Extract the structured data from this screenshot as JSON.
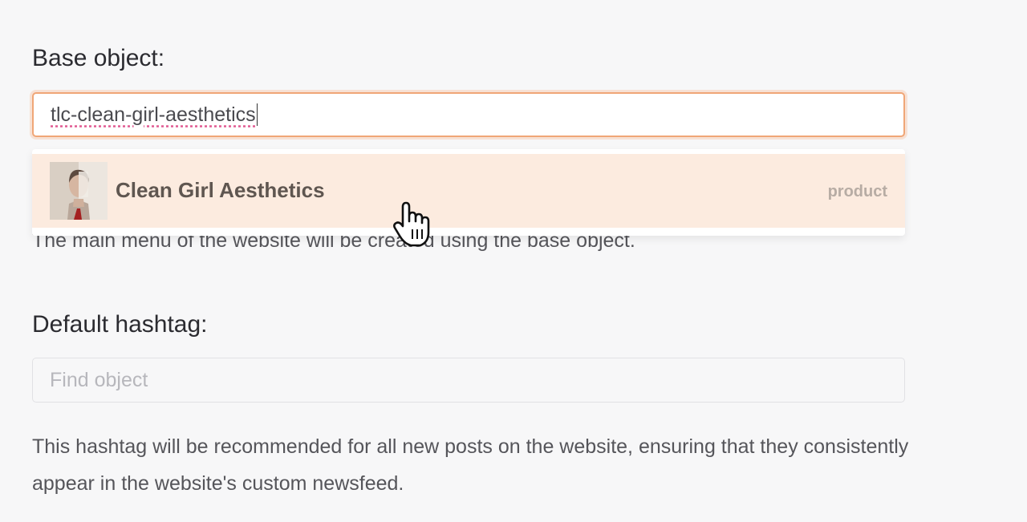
{
  "base_object": {
    "label": "Base object:",
    "input_value": "tlc-clean-girl-aesthetics",
    "suggestion": {
      "title": "Clean Girl Aesthetics",
      "type": "product",
      "thumbnail_icon": "portrait-thumbnail"
    },
    "help_text": "The main menu of the website will be created using the base object."
  },
  "default_hashtag": {
    "label": "Default hashtag:",
    "input_placeholder": "Find object",
    "help_text": "This hashtag will be recommended for all new posts on the website, ensuring that they consistently appear in the website's custom newsfeed."
  },
  "colors": {
    "focus_border": "#f0a677",
    "option_highlight": "#fcebdf",
    "background": "#f7f7f8"
  },
  "cursor_icon": "hand-pointer-icon"
}
